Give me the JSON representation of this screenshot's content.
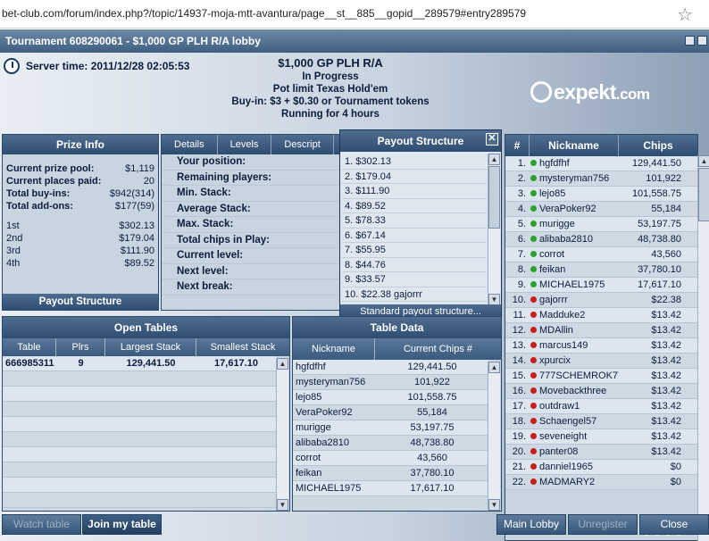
{
  "browser": {
    "url": "bet-club.com/forum/index.php?/topic/14937-moja-mtt-avantura/page__st__885__gopid__289579#entry289579"
  },
  "window": {
    "title": "Tournament 608290061 - $1,000 GP PLH R/A lobby"
  },
  "header": {
    "server_time": "Server time: 2011/12/28 02:05:53",
    "tournament_name": "$1,000 GP PLH R/A",
    "status": "In Progress",
    "game": "Pot limit Texas Hold'em",
    "buyin": "Buy-in: $3 + $0.30 or Tournament tokens",
    "running": "Running for 4 hours",
    "logo": "expekt",
    "logo_suffix": ".com"
  },
  "prize_info": {
    "title": "Prize Info",
    "rows": [
      {
        "k": "Current prize pool:",
        "v": "$1,119"
      },
      {
        "k": "Current places paid:",
        "v": "20"
      },
      {
        "k": "Total buy-ins:",
        "v": "$942(314)"
      },
      {
        "k": "Total add-ons:",
        "v": "$177(59)"
      }
    ],
    "places": [
      {
        "k": "1st",
        "v": "$302.13"
      },
      {
        "k": "2nd",
        "v": "$179.04"
      },
      {
        "k": "3rd",
        "v": "$111.90"
      },
      {
        "k": "4th",
        "v": "$89.52"
      }
    ],
    "button": "Payout Structure"
  },
  "details": {
    "tabs": [
      "Details",
      "Levels",
      "Descript"
    ],
    "rows": [
      "Your position:",
      "Remaining players:",
      "Min. Stack:",
      "Average Stack:",
      "Max. Stack:",
      "Total chips in Play:",
      "Current level:",
      "Next level:",
      "Next break:"
    ]
  },
  "payout": {
    "title": "Payout Structure",
    "items": [
      "1. $302.13",
      "2. $179.04",
      "3. $111.90",
      "4. $89.52",
      "5. $78.33",
      "6. $67.14",
      "7. $55.95",
      "8. $44.76",
      "9. $33.57",
      "10. $22.38 gajorrr"
    ],
    "footer": "Standard payout structure..."
  },
  "players": {
    "headers": [
      "#",
      "Nickname",
      "Chips"
    ],
    "rows": [
      {
        "n": "1.",
        "name": "hgfdfhf",
        "chips": "129,441.50",
        "c": "#2ea02e"
      },
      {
        "n": "2.",
        "name": "mysteryman756",
        "chips": "101,922",
        "c": "#2ea02e"
      },
      {
        "n": "3.",
        "name": "lejo85",
        "chips": "101,558.75",
        "c": "#2ea02e"
      },
      {
        "n": "4.",
        "name": "VeraPoker92",
        "chips": "55,184",
        "c": "#2ea02e"
      },
      {
        "n": "5.",
        "name": "murigge",
        "chips": "53,197.75",
        "c": "#2ea02e"
      },
      {
        "n": "6.",
        "name": "alibaba2810",
        "chips": "48,738.80",
        "c": "#2ea02e"
      },
      {
        "n": "7.",
        "name": "corrot",
        "chips": "43,560",
        "c": "#2ea02e"
      },
      {
        "n": "8.",
        "name": "feikan",
        "chips": "37,780.10",
        "c": "#2ea02e"
      },
      {
        "n": "9.",
        "name": "MICHAEL1975",
        "chips": "17,617.10",
        "c": "#2ea02e"
      },
      {
        "n": "10.",
        "name": "gajorrr",
        "chips": "$22.38",
        "c": "#c81e1e"
      },
      {
        "n": "11.",
        "name": "Madduke2",
        "chips": "$13.42",
        "c": "#c81e1e"
      },
      {
        "n": "12.",
        "name": "MDAllin",
        "chips": "$13.42",
        "c": "#c81e1e"
      },
      {
        "n": "13.",
        "name": "marcus149",
        "chips": "$13.42",
        "c": "#c81e1e"
      },
      {
        "n": "14.",
        "name": "xpurcix",
        "chips": "$13.42",
        "c": "#c81e1e"
      },
      {
        "n": "15.",
        "name": "777SCHEMROK77",
        "chips": "$13.42",
        "c": "#c81e1e"
      },
      {
        "n": "16.",
        "name": "Movebackthree",
        "chips": "$13.42",
        "c": "#c81e1e"
      },
      {
        "n": "17.",
        "name": "outdraw1",
        "chips": "$13.42",
        "c": "#c81e1e"
      },
      {
        "n": "18.",
        "name": "Schaengel57",
        "chips": "$13.42",
        "c": "#c81e1e"
      },
      {
        "n": "19.",
        "name": "seveneight",
        "chips": "$13.42",
        "c": "#c81e1e"
      },
      {
        "n": "20.",
        "name": "panter08",
        "chips": "$13.42",
        "c": "#c81e1e"
      },
      {
        "n": "21.",
        "name": "danniel1965",
        "chips": "$0",
        "c": "#c81e1e"
      },
      {
        "n": "22.",
        "name": "MADMARY2",
        "chips": "$0",
        "c": "#c81e1e"
      }
    ]
  },
  "open_tables": {
    "title": "Open Tables",
    "headers": [
      "Table",
      "Plrs",
      "Largest Stack",
      "Smallest Stack"
    ],
    "rows": [
      {
        "table": "666985311",
        "plrs": "9",
        "largest": "129,441.50",
        "smallest": "17,617.10"
      }
    ]
  },
  "table_data": {
    "title": "Table Data",
    "headers": [
      "Nickname",
      "Current Chips #"
    ],
    "rows": [
      {
        "name": "hgfdfhf",
        "chips": "129,441.50"
      },
      {
        "name": "mysteryman756",
        "chips": "101,922"
      },
      {
        "name": "lejo85",
        "chips": "101,558.75"
      },
      {
        "name": "VeraPoker92",
        "chips": "55,184"
      },
      {
        "name": "murigge",
        "chips": "53,197.75"
      },
      {
        "name": "alibaba2810",
        "chips": "48,738.80"
      },
      {
        "name": "corrot",
        "chips": "43,560"
      },
      {
        "name": "feikan",
        "chips": "37,780.10"
      },
      {
        "name": "MICHAEL1975",
        "chips": "17,617.10"
      }
    ]
  },
  "buttons": {
    "watch": "Watch table",
    "join": "Join my table",
    "main_lobby": "Main Lobby",
    "unregister": "Unregister",
    "close": "Close"
  },
  "colors": {
    "status_dots": [
      "#d42a2a",
      "#2ea02e",
      "#e8c21e",
      "#d42a2a"
    ]
  }
}
